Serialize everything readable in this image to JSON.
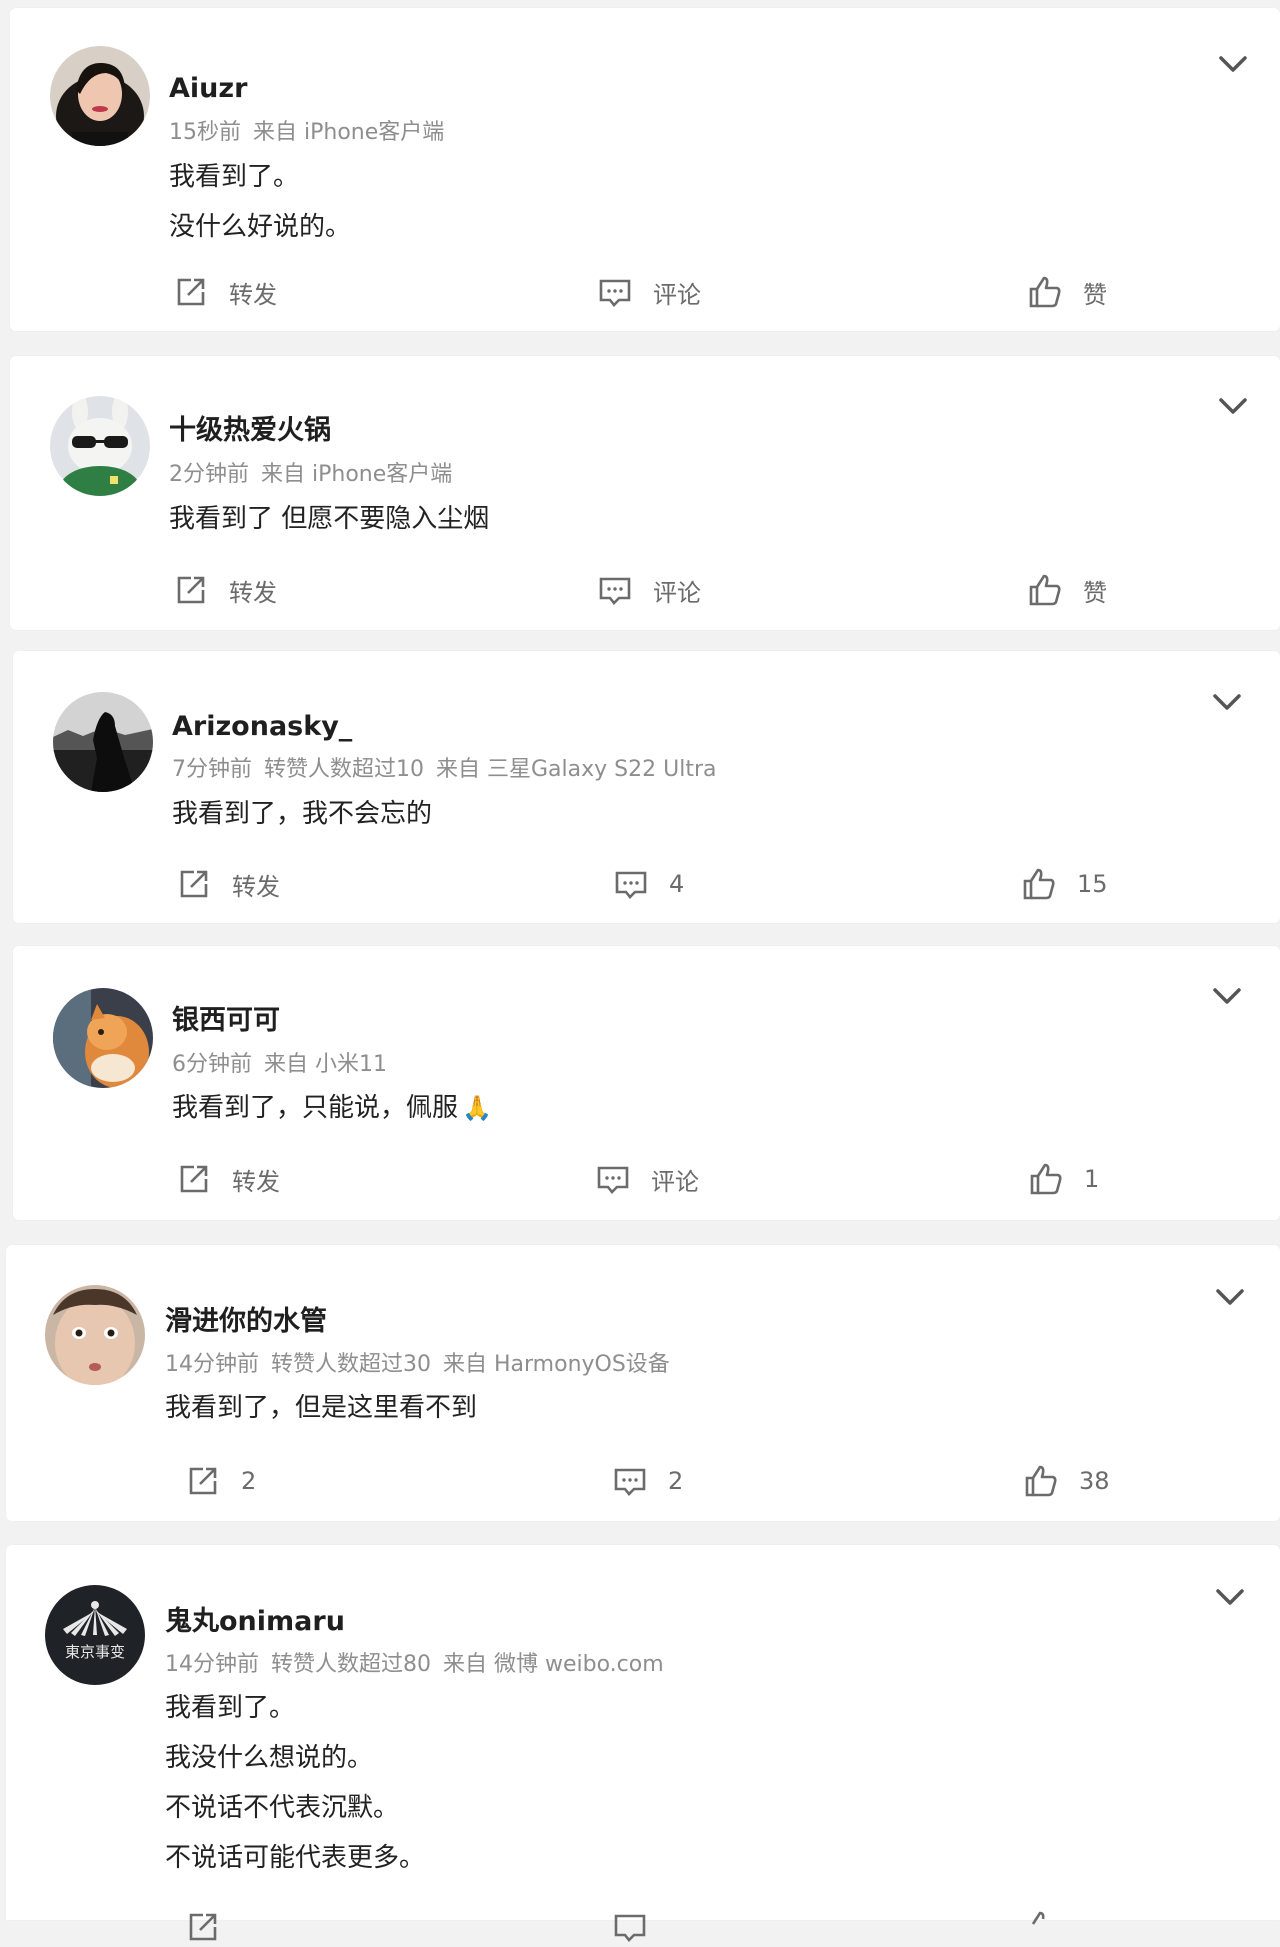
{
  "posts": [
    {
      "name": "Aiuzr",
      "time": "15秒前",
      "popularity": "",
      "source": "来自 iPhone客户端",
      "lines": [
        "我看到了。",
        "没什么好说的。"
      ],
      "repost": "转发",
      "comment": "评论",
      "like": "赞",
      "avatar_icon": "avatar-portrait-woman"
    },
    {
      "name": "十级热爱火锅",
      "time": "2分钟前",
      "popularity": "",
      "source": "来自 iPhone客户端",
      "lines": [
        "我看到了 但愿不要隐入尘烟"
      ],
      "repost": "转发",
      "comment": "评论",
      "like": "赞",
      "avatar_icon": "avatar-white-dog-sunglasses"
    },
    {
      "name": "Arizonasky_",
      "time": "7分钟前",
      "popularity": "转赞人数超过10",
      "source": "来自 三星Galaxy S22 Ultra",
      "lines": [
        "我看到了，我不会忘的"
      ],
      "repost": "转发",
      "comment": "4",
      "like": "15",
      "avatar_icon": "avatar-dark-landscape-figure"
    },
    {
      "name": "银西可可",
      "time": "6分钟前",
      "popularity": "",
      "source": "来自 小米11",
      "lines": [
        "我看到了，只能说，佩服"
      ],
      "emoji": "🙏",
      "repost": "转发",
      "comment": "评论",
      "like": "1",
      "avatar_icon": "avatar-orange-cat"
    },
    {
      "name": "滑进你的水管",
      "time": "14分钟前",
      "popularity": "转赞人数超过30",
      "source": "来自 HarmonyOS设备",
      "lines": [
        "我看到了，但是这里看不到"
      ],
      "repost": "2",
      "comment": "2",
      "like": "38",
      "avatar_icon": "avatar-face-closeup"
    },
    {
      "name": "鬼丸onimaru",
      "time": "14分钟前",
      "popularity": "转赞人数超过80",
      "source": "来自 微博 weibo.com",
      "lines": [
        "我看到了。",
        "我没什么想说的。",
        "不说话不代表沉默。",
        "不说话可能代表更多。"
      ],
      "repost": "",
      "comment": "",
      "like": "",
      "avatar_icon": "avatar-tokyo-incidents-logo",
      "avatar_text": "東京事变"
    }
  ],
  "colors": {
    "page_bg": "#f2f2f2",
    "card_bg": "#ffffff",
    "name": "#1f1f1f",
    "meta": "#8e8e8e",
    "action": "#6b6b6b"
  }
}
